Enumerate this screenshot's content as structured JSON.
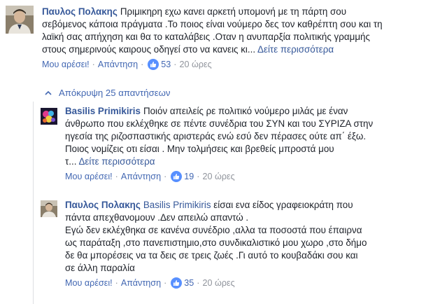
{
  "colors": {
    "link_blue": "#365899",
    "action_blue": "#4267b2",
    "muted_gray": "#90949c",
    "text": "#1d2129",
    "like_badge": "#5890ff"
  },
  "comments": [
    {
      "author": "Παυλος Πολακης",
      "lines": [
        "Πριμικηρη εχω κανει αρκετή υπομονή με τη πάρτη σου",
        "σεβόμενος κάποια πράγματα .Το ποιος είναι νούμερο δες τον καθρέπτη σου και τη",
        "λαϊκή σας απήχηση και θα το καταλάβεις .Οταν η ανυπαρξία πολιτικής γραμμής",
        "στους σημερινούς καιρους οδηγεί στο να κανεις κι... "
      ],
      "see_more": "Δείτε περισσότερα",
      "like_label": "Μου αρέσει!",
      "reply_label": "Απάντηση",
      "likes": "53",
      "time": "20 ώρες",
      "like_icon": "thumbs-up-icon"
    },
    {
      "author": "Basilis Primikiris",
      "lines": [
        "Ποιόν απειλείς ρε πολιτικό νούμερο μιλάς με έναν",
        "άνθρωπο που εκλέχθηκε σε πέντε συνέδρια του ΣΥΝ και του ΣΥΡΙΖΑ στην",
        "ηγεσία της ριζοσπαστικής αριστεράς ενώ εσύ δεν πέρασες ούτε απ΄ έξω.",
        "Ποιος νομίζεις οτι είσαι . Μην τολμήσεις και βρεθείς μπροστά μου",
        "τ... "
      ],
      "see_more": "Δείτε περισσότερα",
      "like_label": "Μου αρέσει!",
      "reply_label": "Απάντηση",
      "likes": "19",
      "time": "20 ώρες"
    },
    {
      "author": "Παυλος Πολακης",
      "mention": "Basilis Primikiris",
      "first_line_rest": " είσαι ενα είδος γραφειοκράτη που",
      "lines": [
        "πάντα απεχθανομουν .Δεν απειλώ απαντώ .",
        "Εγώ δεν εκλέχθηκα σε κανένα συνέδριο ,αλλα τα ποσοστά που έπαιρνα",
        "ως παράταξη ,στο πανεπιστημιο,στο συνδικαλιστικό μου χωρο ,στο δήμο",
        "δε θα μπορέσεις να τα δεις σε τρεις ζωές .Γι αυτό το κουβαδάκι σου και",
        "σε άλλη παραλία"
      ],
      "like_label": "Μου αρέσει!",
      "reply_label": "Απάντηση",
      "likes": "35",
      "time": "20 ώρες"
    }
  ],
  "hide_replies": {
    "label": "Απόκρυψη 25 απαντήσεων",
    "icon": "chevron-up-icon"
  }
}
